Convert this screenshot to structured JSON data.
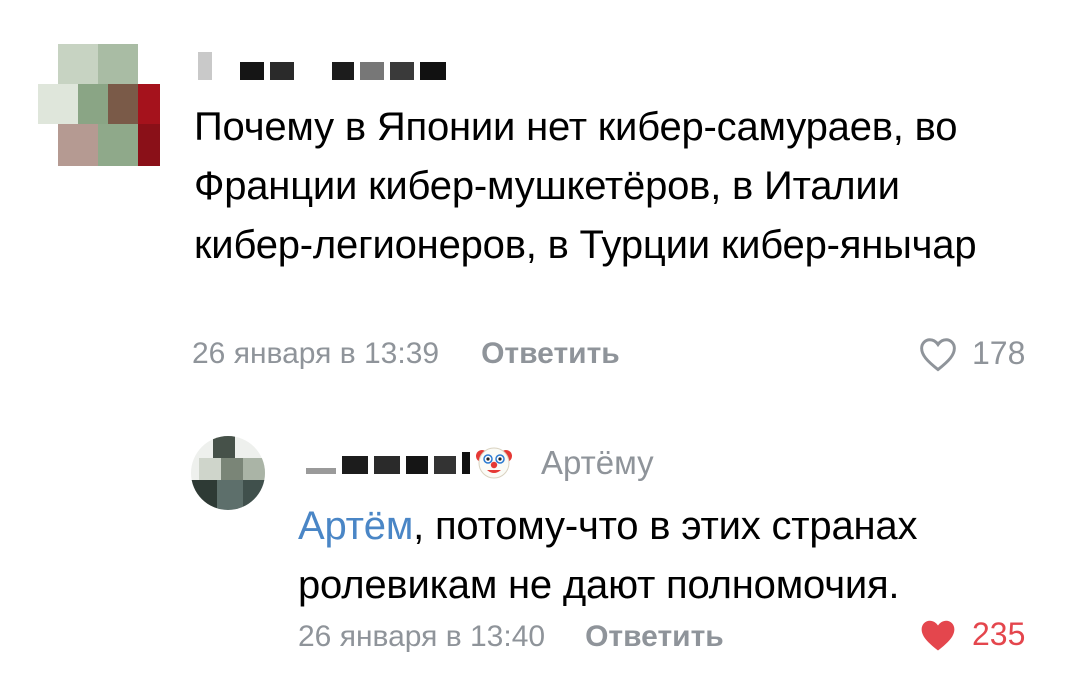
{
  "comment": {
    "text": "Почему в Японии нет кибер-самураев, во Франции кибер-мушкетёров, в Италии кибер-легионеров, в Турции кибер-янычар",
    "date": "26 января в 13:39",
    "reply_label": "Ответить",
    "likes": "178",
    "liked": false
  },
  "reply": {
    "to_label": "Артёму",
    "mention": "Артём",
    "text": ", потому-что в этих странах ролевикам не дают полномочия.",
    "date": "26 января в 13:40",
    "reply_label": "Ответить",
    "likes": "235",
    "liked": true
  },
  "colors": {
    "meta_gray": "#8f949a",
    "link_blue": "#4a86c6",
    "like_red": "#e4464d"
  },
  "icons": [
    "heart-outline-icon",
    "heart-filled-icon",
    "clown-emoji-icon"
  ]
}
